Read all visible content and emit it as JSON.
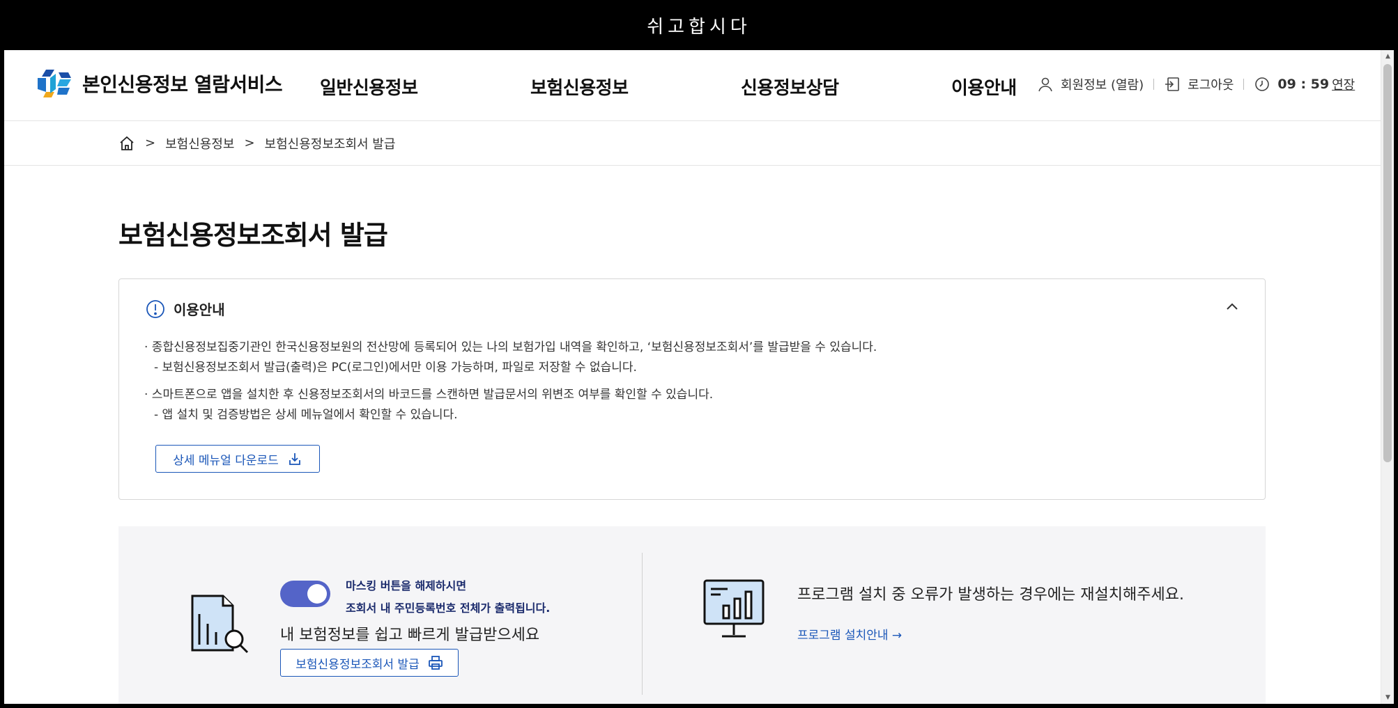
{
  "top_banner": "쉬고합시다",
  "header": {
    "logo_text": "본인신용정보 열람서비스",
    "nav": [
      "일반신용정보",
      "보험신용정보",
      "신용정보상담",
      "이용안내"
    ],
    "member_info": "회원정보 (열람)",
    "logout": "로그아웃",
    "timer": "09 : 59",
    "extend": "연장"
  },
  "breadcrumb": {
    "items": [
      "보험신용정보",
      "보험신용정보조회서 발급"
    ]
  },
  "page_title": "보험신용정보조회서 발급",
  "info_box": {
    "heading": "이용안내",
    "items": [
      {
        "main": "· 종합신용정보집중기관인 한국신용정보원의 전산망에 등록되어 있는 나의 보험가입 내역을 확인하고, ‘보험신용정보조회서’를 발급받을 수 있습니다.",
        "sub": "- 보험신용정보조회서 발급(출력)은 PC(로그인)에서만 이용 가능하며, 파일로 저장할 수 없습니다."
      },
      {
        "main": "· 스마트폰으로 앱을 설치한 후 신용정보조회서의 바코드를 스캔하면 발급문서의 위변조 여부를 확인할 수 있습니다.",
        "sub": "- 앱 설치 및 검증방법은 상세 메뉴얼에서 확인할 수 있습니다."
      }
    ],
    "manual_button": "상세 메뉴얼 다운로드"
  },
  "issue_panel": {
    "toggle_on": true,
    "mask_line1": "마스킹 버튼을 해제하시면",
    "mask_line2": "조회서 내 주민등록번호 전체가 출력됩니다.",
    "description": "내 보험정보를 쉽고 빠르게 발급받으세요",
    "issue_button": "보험신용정보조회서 발급"
  },
  "program_panel": {
    "text": "프로그램 설치 중 오류가 발생하는 경우에는 재설치해주세요.",
    "link": "프로그램 설치안내 →"
  },
  "colors": {
    "accent_blue": "#1a56b8",
    "toggle": "#5464c8",
    "panel_bg": "#f5f5f7"
  }
}
